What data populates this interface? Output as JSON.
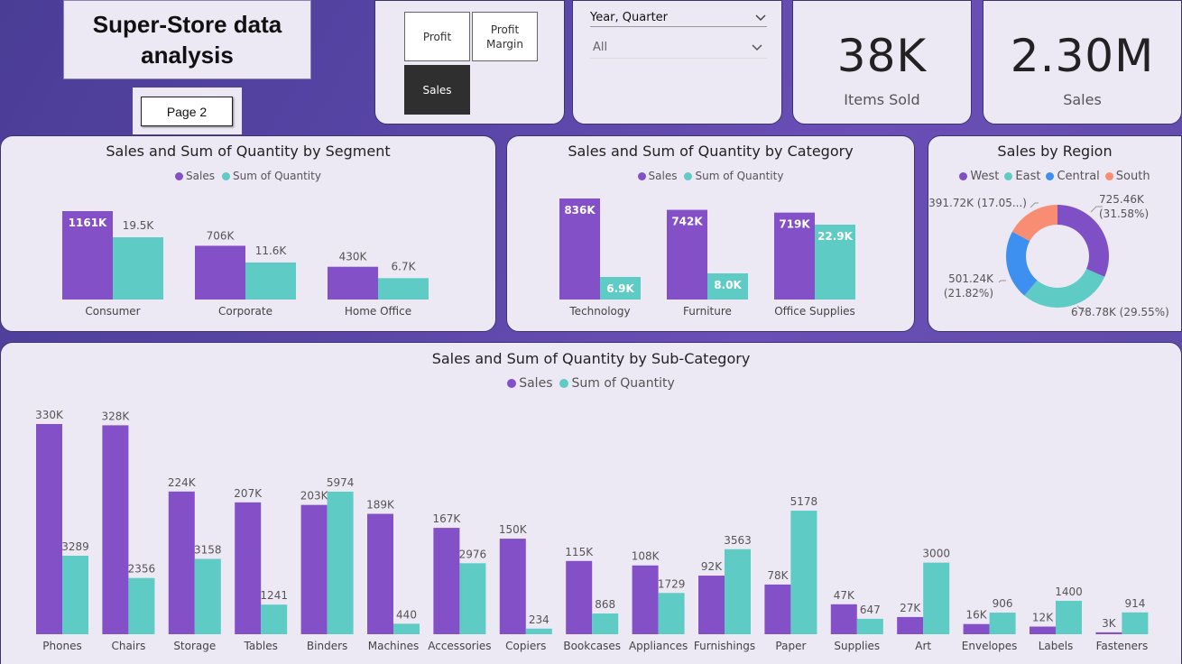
{
  "header": {
    "title_line1": "Super-Store data",
    "title_line2": "analysis",
    "page_button": "Page 2"
  },
  "metric_slicer": {
    "profit": "Profit",
    "profit_margin_line1": "Profit",
    "profit_margin_line2": "Margin",
    "sales": "Sales",
    "selected": "Sales"
  },
  "filters": {
    "date_hierarchy": "Year, Quarter",
    "date_value": "All"
  },
  "kpis": {
    "items_sold_value": "38K",
    "items_sold_label": "Items Sold",
    "sales_value": "2.30M",
    "sales_label": "Sales"
  },
  "colors": {
    "sales": "#8350c8",
    "quantity": "#5ecbc5",
    "west": "#7f4fc6",
    "east": "#5ecbc5",
    "central": "#3d8ff0",
    "south": "#f98d73"
  },
  "chart_data": [
    {
      "id": "segment",
      "type": "bar",
      "title": "Sales and Sum of Quantity by Segment",
      "legend": [
        "Sales",
        "Sum of Quantity"
      ],
      "categories": [
        "Consumer",
        "Corporate",
        "Home Office"
      ],
      "series": [
        {
          "name": "Sales",
          "values": [
            1161,
            706,
            430
          ],
          "labels": [
            "1161K",
            "706K",
            "430K"
          ]
        },
        {
          "name": "Sum of Quantity",
          "values": [
            19.5,
            11.6,
            6.7
          ],
          "labels": [
            "19.5K",
            "11.6K",
            "6.7K"
          ]
        }
      ]
    },
    {
      "id": "category",
      "type": "bar",
      "title": "Sales and Sum of Quantity by Category",
      "legend": [
        "Sales",
        "Sum of Quantity"
      ],
      "categories": [
        "Technology",
        "Furniture",
        "Office Supplies"
      ],
      "series": [
        {
          "name": "Sales",
          "values": [
            836,
            742,
            719
          ],
          "labels": [
            "836K",
            "742K",
            "719K"
          ]
        },
        {
          "name": "Sum of Quantity",
          "values": [
            6.9,
            8.0,
            22.9
          ],
          "labels": [
            "6.9K",
            "8.0K",
            "22.9K"
          ]
        }
      ]
    },
    {
      "id": "region",
      "type": "pie",
      "title": "Sales by Region",
      "legend": [
        "West",
        "East",
        "Central",
        "South"
      ],
      "slices": [
        {
          "name": "West",
          "value": 725.46,
          "label_line1": "725.46K",
          "label_line2": "(31.58%)"
        },
        {
          "name": "East",
          "value": 678.78,
          "label_line1": "678.78K (29.55%)",
          "label_line2": ""
        },
        {
          "name": "Central",
          "value": 501.24,
          "label_line1": "501.24K",
          "label_line2": "(21.82%)"
        },
        {
          "name": "South",
          "value": 391.72,
          "label_line1": "391.72K (17.05...)",
          "label_line2": ""
        }
      ]
    },
    {
      "id": "subcategory",
      "type": "bar",
      "title": "Sales and Sum of Quantity by Sub-Category",
      "legend": [
        "Sales",
        "Sum of Quantity"
      ],
      "categories": [
        "Phones",
        "Chairs",
        "Storage",
        "Tables",
        "Binders",
        "Machines",
        "Accessories",
        "Copiers",
        "Bookcases",
        "Appliances",
        "Furnishings",
        "Paper",
        "Supplies",
        "Art",
        "Envelopes",
        "Labels",
        "Fasteners"
      ],
      "series": [
        {
          "name": "Sales",
          "values": [
            330,
            328,
            224,
            207,
            203,
            189,
            167,
            150,
            115,
            108,
            92,
            78,
            47,
            27,
            16,
            12,
            3
          ],
          "labels": [
            "330K",
            "328K",
            "224K",
            "207K",
            "203K",
            "189K",
            "167K",
            "150K",
            "115K",
            "108K",
            "92K",
            "78K",
            "47K",
            "27K",
            "16K",
            "12K",
            "3K"
          ]
        },
        {
          "name": "Sum of Quantity",
          "values": [
            3289,
            2356,
            3158,
            1241,
            5974,
            440,
            2976,
            234,
            868,
            1729,
            3563,
            5178,
            647,
            3000,
            906,
            1400,
            914
          ],
          "labels": [
            "3289",
            "2356",
            "3158",
            "1241",
            "5974",
            "440",
            "2976",
            "234",
            "868",
            "1729",
            "3563",
            "5178",
            "647",
            "3000",
            "906",
            "1400",
            "914"
          ]
        }
      ]
    }
  ]
}
